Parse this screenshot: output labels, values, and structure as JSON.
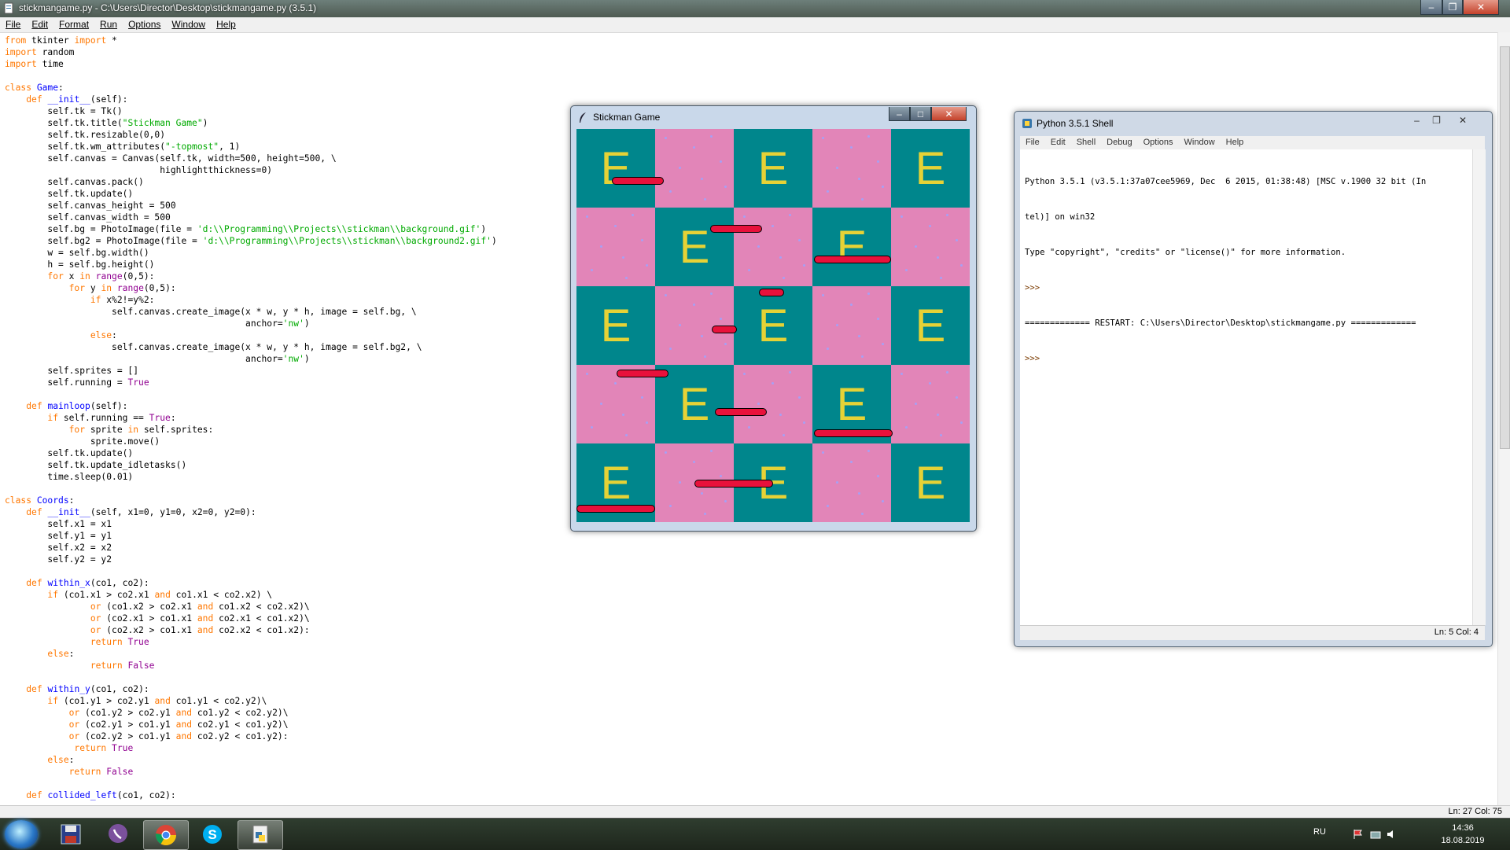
{
  "editor": {
    "title": "stickmangame.py - C:\\Users\\Director\\Desktop\\stickmangame.py (3.5.1)",
    "menu": [
      "File",
      "Edit",
      "Format",
      "Run",
      "Options",
      "Window",
      "Help"
    ],
    "status": "Ln: 27    Col: 75",
    "code": [
      "from tkinter import *",
      "import random",
      "import time",
      "",
      "class Game:",
      "    def __init__(self):",
      "        self.tk = Tk()",
      "        self.tk.title(\"Stickman Game\")",
      "        self.tk.resizable(0,0)",
      "        self.tk.wm_attributes(\"-topmost\", 1)",
      "        self.canvas = Canvas(self.tk, width=500, height=500, \\",
      "                             highlightthickness=0)",
      "        self.canvas.pack()",
      "        self.tk.update()",
      "        self.canvas_height = 500",
      "        self.canvas_width = 500",
      "        self.bg = PhotoImage(file = 'd:\\\\Programming\\\\Projects\\\\stickman\\\\background.gif')",
      "        self.bg2 = PhotoImage(file = 'd:\\\\Programming\\\\Projects\\\\stickman\\\\background2.gif')",
      "        w = self.bg.width()",
      "        h = self.bg.height()",
      "        for x in range(0,5):",
      "            for y in range(0,5):",
      "                if x%2!=y%2:",
      "                    self.canvas.create_image(x * w, y * h, image = self.bg, \\",
      "                                             anchor='nw')",
      "                else:",
      "                    self.canvas.create_image(x * w, y * h, image = self.bg2, \\",
      "                                             anchor='nw')",
      "        self.sprites = []",
      "        self.running = True",
      "",
      "    def mainloop(self):",
      "        if self.running == True:",
      "            for sprite in self.sprites:",
      "                sprite.move()",
      "        self.tk.update()",
      "        self.tk.update_idletasks()",
      "        time.sleep(0.01)",
      "",
      "class Coords:",
      "    def __init__(self, x1=0, y1=0, x2=0, y2=0):",
      "        self.x1 = x1",
      "        self.y1 = y1",
      "        self.x2 = x2",
      "        self.y2 = y2",
      "",
      "    def within_x(co1, co2):",
      "        if (co1.x1 > co2.x1 and co1.x1 < co2.x2) \\",
      "                or (co1.x2 > co2.x1 and co1.x2 < co2.x2)\\",
      "                or (co2.x1 > co1.x1 and co2.x1 < co1.x2)\\",
      "                or (co2.x2 > co1.x1 and co2.x2 < co1.x2):",
      "                return True",
      "        else:",
      "                return False",
      "",
      "    def within_y(co1, co2):",
      "        if (co1.y1 > co2.y1 and co1.y1 < co2.y2)\\",
      "            or (co1.y2 > co2.y1 and co1.y2 < co2.y2)\\",
      "            or (co2.y1 > co1.y1 and co2.y1 < co1.y2)\\",
      "            or (co2.y2 > co1.y1 and co2.y2 < co1.y2):",
      "             return True",
      "        else:",
      "            return False",
      "",
      "    def collided_left(co1, co2):"
    ]
  },
  "game_window": {
    "title": "Stickman Game",
    "tile_letter": "E",
    "colors": {
      "teal": "#00868c",
      "pink": "#e285b8",
      "letter": "#e6d236",
      "platform": "#e8113b"
    }
  },
  "shell": {
    "title": "Python 3.5.1 Shell",
    "menu": [
      "File",
      "Edit",
      "Shell",
      "Debug",
      "Options",
      "Window",
      "Help"
    ],
    "lines": [
      "Python 3.5.1 (v3.5.1:37a07cee5969, Dec  6 2015, 01:38:48) [MSC v.1900 32 bit (In",
      "tel)] on win32",
      "Type \"copyright\", \"credits\" or \"license()\" for more information.",
      ">>> ",
      "============= RESTART: C:\\Users\\Director\\Desktop\\stickmangame.py =============",
      ">>> "
    ],
    "status": "Ln: 5    Col: 4"
  },
  "taskbar": {
    "apps": [
      "floppy-save-icon",
      "viber-icon",
      "chrome-icon",
      "skype-icon",
      "python-idle-icon"
    ],
    "language": "RU",
    "time": "14:36",
    "date": "18.08.2019"
  }
}
